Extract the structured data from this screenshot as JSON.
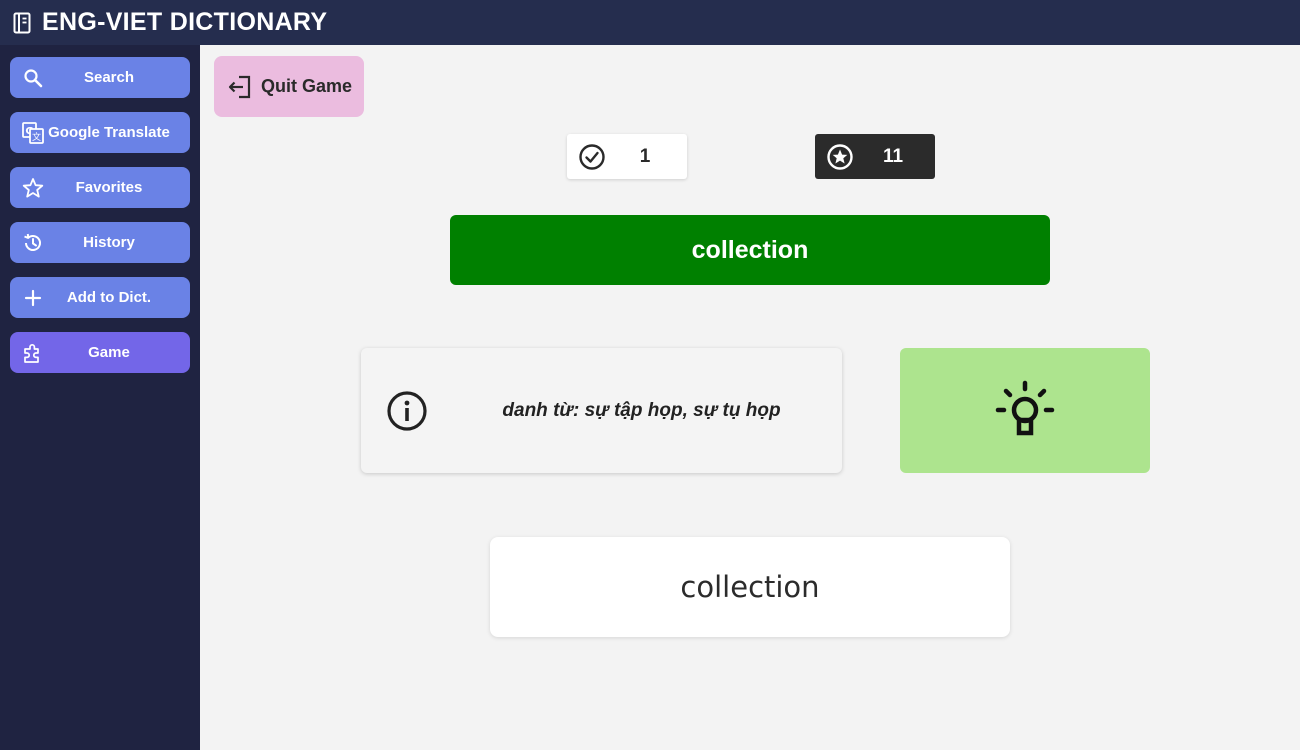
{
  "app": {
    "title": "ENG-VIET DICTIONARY",
    "logo_icon": "notebook-icon"
  },
  "sidebar": {
    "items": [
      {
        "label": "Search",
        "icon": "search-icon"
      },
      {
        "label": "Google Translate",
        "icon": "translate-icon"
      },
      {
        "label": "Favorites",
        "icon": "star-outline-icon"
      },
      {
        "label": "History",
        "icon": "history-icon"
      },
      {
        "label": "Add to Dict.",
        "icon": "plus-icon"
      },
      {
        "label": "Game",
        "icon": "puzzle-icon",
        "active": true
      }
    ]
  },
  "game": {
    "quit_label": "Quit Game",
    "correct_count": "1",
    "score": "11",
    "word": "collection",
    "hint": "danh từ: sự tập họp, sự tụ họp",
    "answer_value": "collection"
  },
  "colors": {
    "topbar": "#252d4e",
    "sidebar": "#1f2341",
    "nav_button": "#6a82e6",
    "nav_button_active": "#7366e8",
    "quit_button": "#ebbcdf",
    "word_banner": "#008000",
    "idea_button": "#ade48e",
    "score_box": "#2b2b2b"
  }
}
